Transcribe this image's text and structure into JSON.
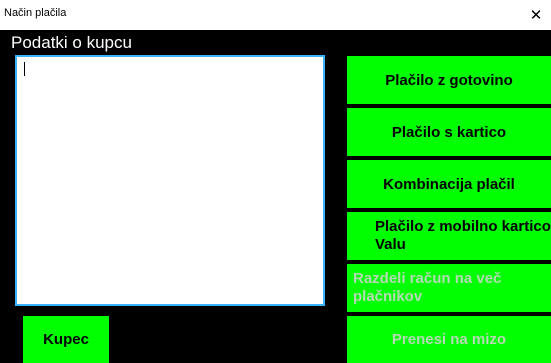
{
  "window": {
    "title": "Način plačila",
    "close_glyph": "✕"
  },
  "section": {
    "header": "Podatki o kupcu"
  },
  "textbox": {
    "value": ""
  },
  "buttons": {
    "cash": "Plačilo z gotovino",
    "card": "Plačilo s kartico",
    "combination": "Kombinacija plačil",
    "mobile": "Plačilo z mobilno kartico Valu",
    "split": "Razdeli račun na več plačnikov",
    "transfer": "Prenesi na mizo",
    "customer": "Kupec"
  },
  "colors": {
    "button_bg": "#00ff00",
    "background": "#000000",
    "textbox_border": "#38b3ff",
    "disabled_text": "#b6d8b6"
  }
}
